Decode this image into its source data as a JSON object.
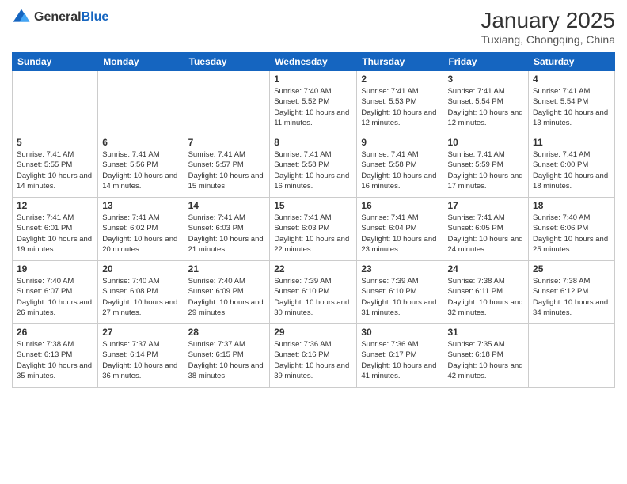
{
  "logo": {
    "general": "General",
    "blue": "Blue"
  },
  "header": {
    "month": "January 2025",
    "location": "Tuxiang, Chongqing, China"
  },
  "weekdays": [
    "Sunday",
    "Monday",
    "Tuesday",
    "Wednesday",
    "Thursday",
    "Friday",
    "Saturday"
  ],
  "weeks": [
    [
      {
        "day": "",
        "sunrise": "",
        "sunset": "",
        "daylight": "",
        "empty": true
      },
      {
        "day": "",
        "sunrise": "",
        "sunset": "",
        "daylight": "",
        "empty": true
      },
      {
        "day": "",
        "sunrise": "",
        "sunset": "",
        "daylight": "",
        "empty": true
      },
      {
        "day": "1",
        "sunrise": "Sunrise: 7:40 AM",
        "sunset": "Sunset: 5:52 PM",
        "daylight": "Daylight: 10 hours and 11 minutes."
      },
      {
        "day": "2",
        "sunrise": "Sunrise: 7:41 AM",
        "sunset": "Sunset: 5:53 PM",
        "daylight": "Daylight: 10 hours and 12 minutes."
      },
      {
        "day": "3",
        "sunrise": "Sunrise: 7:41 AM",
        "sunset": "Sunset: 5:54 PM",
        "daylight": "Daylight: 10 hours and 12 minutes."
      },
      {
        "day": "4",
        "sunrise": "Sunrise: 7:41 AM",
        "sunset": "Sunset: 5:54 PM",
        "daylight": "Daylight: 10 hours and 13 minutes."
      }
    ],
    [
      {
        "day": "5",
        "sunrise": "Sunrise: 7:41 AM",
        "sunset": "Sunset: 5:55 PM",
        "daylight": "Daylight: 10 hours and 14 minutes."
      },
      {
        "day": "6",
        "sunrise": "Sunrise: 7:41 AM",
        "sunset": "Sunset: 5:56 PM",
        "daylight": "Daylight: 10 hours and 14 minutes."
      },
      {
        "day": "7",
        "sunrise": "Sunrise: 7:41 AM",
        "sunset": "Sunset: 5:57 PM",
        "daylight": "Daylight: 10 hours and 15 minutes."
      },
      {
        "day": "8",
        "sunrise": "Sunrise: 7:41 AM",
        "sunset": "Sunset: 5:58 PM",
        "daylight": "Daylight: 10 hours and 16 minutes."
      },
      {
        "day": "9",
        "sunrise": "Sunrise: 7:41 AM",
        "sunset": "Sunset: 5:58 PM",
        "daylight": "Daylight: 10 hours and 16 minutes."
      },
      {
        "day": "10",
        "sunrise": "Sunrise: 7:41 AM",
        "sunset": "Sunset: 5:59 PM",
        "daylight": "Daylight: 10 hours and 17 minutes."
      },
      {
        "day": "11",
        "sunrise": "Sunrise: 7:41 AM",
        "sunset": "Sunset: 6:00 PM",
        "daylight": "Daylight: 10 hours and 18 minutes."
      }
    ],
    [
      {
        "day": "12",
        "sunrise": "Sunrise: 7:41 AM",
        "sunset": "Sunset: 6:01 PM",
        "daylight": "Daylight: 10 hours and 19 minutes."
      },
      {
        "day": "13",
        "sunrise": "Sunrise: 7:41 AM",
        "sunset": "Sunset: 6:02 PM",
        "daylight": "Daylight: 10 hours and 20 minutes."
      },
      {
        "day": "14",
        "sunrise": "Sunrise: 7:41 AM",
        "sunset": "Sunset: 6:03 PM",
        "daylight": "Daylight: 10 hours and 21 minutes."
      },
      {
        "day": "15",
        "sunrise": "Sunrise: 7:41 AM",
        "sunset": "Sunset: 6:03 PM",
        "daylight": "Daylight: 10 hours and 22 minutes."
      },
      {
        "day": "16",
        "sunrise": "Sunrise: 7:41 AM",
        "sunset": "Sunset: 6:04 PM",
        "daylight": "Daylight: 10 hours and 23 minutes."
      },
      {
        "day": "17",
        "sunrise": "Sunrise: 7:41 AM",
        "sunset": "Sunset: 6:05 PM",
        "daylight": "Daylight: 10 hours and 24 minutes."
      },
      {
        "day": "18",
        "sunrise": "Sunrise: 7:40 AM",
        "sunset": "Sunset: 6:06 PM",
        "daylight": "Daylight: 10 hours and 25 minutes."
      }
    ],
    [
      {
        "day": "19",
        "sunrise": "Sunrise: 7:40 AM",
        "sunset": "Sunset: 6:07 PM",
        "daylight": "Daylight: 10 hours and 26 minutes."
      },
      {
        "day": "20",
        "sunrise": "Sunrise: 7:40 AM",
        "sunset": "Sunset: 6:08 PM",
        "daylight": "Daylight: 10 hours and 27 minutes."
      },
      {
        "day": "21",
        "sunrise": "Sunrise: 7:40 AM",
        "sunset": "Sunset: 6:09 PM",
        "daylight": "Daylight: 10 hours and 29 minutes."
      },
      {
        "day": "22",
        "sunrise": "Sunrise: 7:39 AM",
        "sunset": "Sunset: 6:10 PM",
        "daylight": "Daylight: 10 hours and 30 minutes."
      },
      {
        "day": "23",
        "sunrise": "Sunrise: 7:39 AM",
        "sunset": "Sunset: 6:10 PM",
        "daylight": "Daylight: 10 hours and 31 minutes."
      },
      {
        "day": "24",
        "sunrise": "Sunrise: 7:38 AM",
        "sunset": "Sunset: 6:11 PM",
        "daylight": "Daylight: 10 hours and 32 minutes."
      },
      {
        "day": "25",
        "sunrise": "Sunrise: 7:38 AM",
        "sunset": "Sunset: 6:12 PM",
        "daylight": "Daylight: 10 hours and 34 minutes."
      }
    ],
    [
      {
        "day": "26",
        "sunrise": "Sunrise: 7:38 AM",
        "sunset": "Sunset: 6:13 PM",
        "daylight": "Daylight: 10 hours and 35 minutes."
      },
      {
        "day": "27",
        "sunrise": "Sunrise: 7:37 AM",
        "sunset": "Sunset: 6:14 PM",
        "daylight": "Daylight: 10 hours and 36 minutes."
      },
      {
        "day": "28",
        "sunrise": "Sunrise: 7:37 AM",
        "sunset": "Sunset: 6:15 PM",
        "daylight": "Daylight: 10 hours and 38 minutes."
      },
      {
        "day": "29",
        "sunrise": "Sunrise: 7:36 AM",
        "sunset": "Sunset: 6:16 PM",
        "daylight": "Daylight: 10 hours and 39 minutes."
      },
      {
        "day": "30",
        "sunrise": "Sunrise: 7:36 AM",
        "sunset": "Sunset: 6:17 PM",
        "daylight": "Daylight: 10 hours and 41 minutes."
      },
      {
        "day": "31",
        "sunrise": "Sunrise: 7:35 AM",
        "sunset": "Sunset: 6:18 PM",
        "daylight": "Daylight: 10 hours and 42 minutes."
      },
      {
        "day": "",
        "sunrise": "",
        "sunset": "",
        "daylight": "",
        "empty": true
      }
    ]
  ]
}
